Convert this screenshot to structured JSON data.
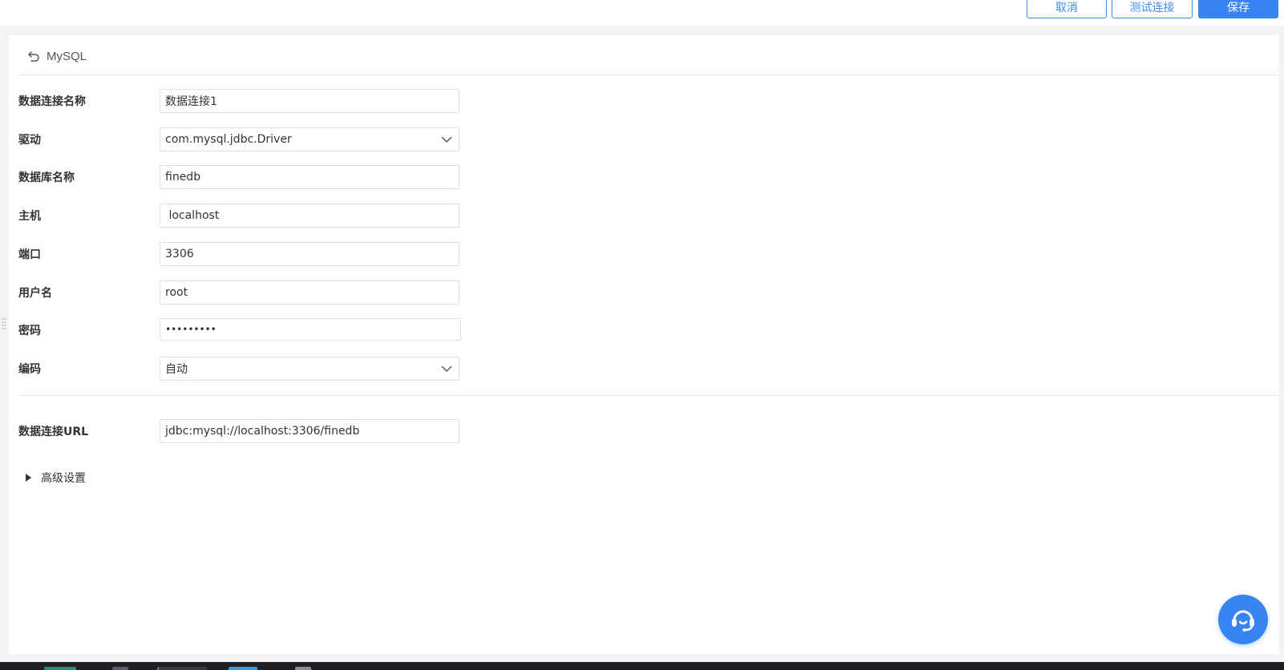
{
  "toolbar": {
    "cancel_label": "取消",
    "test_label": "测试连接",
    "save_label": "保存"
  },
  "panel": {
    "title": "MySQL"
  },
  "form": {
    "connection_name": {
      "label": "数据连接名称",
      "value": "数据连接1"
    },
    "driver": {
      "label": "驱动",
      "value": "com.mysql.jdbc.Driver"
    },
    "database_name": {
      "label": "数据库名称",
      "value": "finedb"
    },
    "host": {
      "label": "主机",
      "value": " localhost"
    },
    "port": {
      "label": "端口",
      "value": "3306"
    },
    "username": {
      "label": "用户名",
      "value": "root"
    },
    "password": {
      "label": "密码",
      "value": "•••••••••"
    },
    "encoding": {
      "label": "编码",
      "value": "自动"
    },
    "url": {
      "label": "数据连接URL",
      "value": "jdbc:mysql://localhost:3306/finedb"
    }
  },
  "advanced": {
    "label": "高级设置"
  },
  "colors": {
    "accent": "#3685f2",
    "border": "#dcdfe4",
    "text": "#333333",
    "background": "#f2f3f5"
  },
  "icons": {
    "back": "undo-arrow-icon",
    "dropdown": "chevron-down-icon",
    "expand": "caret-right-icon",
    "help": "headset-icon"
  }
}
